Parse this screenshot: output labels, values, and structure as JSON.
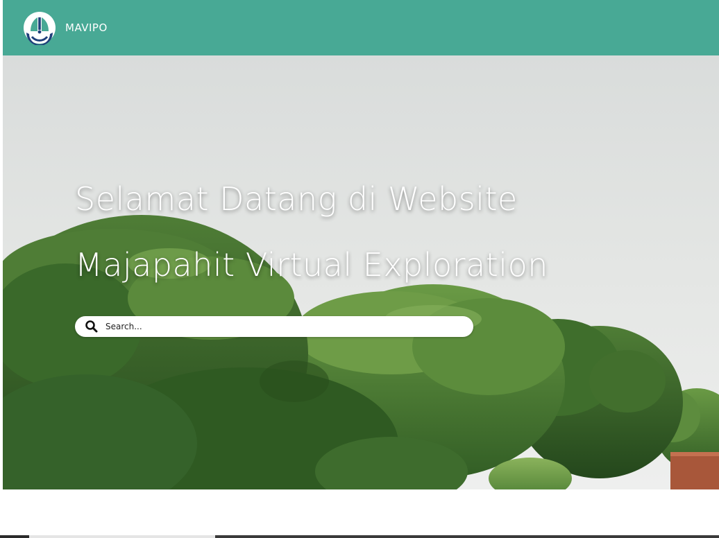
{
  "navbar": {
    "brand_name": "MAVIPO",
    "logo_icon": "mavipo-logo-icon",
    "colors": {
      "background": "#48a995",
      "text": "#ffffff"
    }
  },
  "hero": {
    "title_line1": "Selamat Datang di Website",
    "title_line2": "Majapahit Virtual Exploration",
    "background": "trees-and-sky-photo"
  },
  "search": {
    "placeholder": "Search...",
    "value": "",
    "icon": "search-icon"
  }
}
